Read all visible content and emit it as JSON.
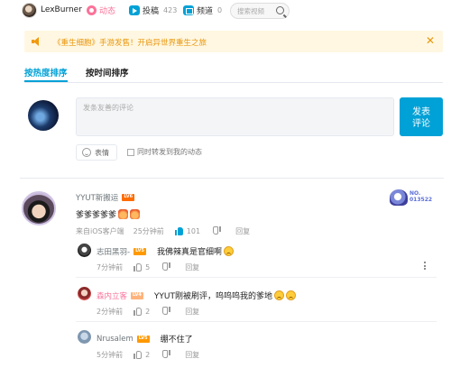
{
  "nav": {
    "username": "LexBurner",
    "dynamic_label": "动态",
    "submissions_label": "投稿",
    "submissions_count": "423",
    "channels_label": "频道",
    "channels_count": "0",
    "search_placeholder": "搜索视频"
  },
  "notice": {
    "text": "《重生细胞》手游发售！开启异世界重生之旅",
    "close": "✕"
  },
  "tabs": [
    {
      "label": "按热度排序",
      "active": true
    },
    {
      "label": "按时间排序",
      "active": false
    }
  ],
  "composer": {
    "placeholder": "发条友善的评论",
    "send_label": "发表\n评论",
    "emoji_label": "表情",
    "repost_label": "同时转发到我的动态"
  },
  "comment": {
    "username": "YYUT新搬运",
    "level": "LV6",
    "text": "爹爹爹爹爹",
    "source": "来自iOS客户端",
    "time": "25分钟前",
    "likes": "101",
    "reply_label": "回复",
    "badge_no": "NO.",
    "badge_num": "013522"
  },
  "replies": [
    {
      "username": "志田黑羽-",
      "level": "LV5",
      "text": "我佛辣真是官细啊",
      "time": "7分钟前",
      "likes": "5",
      "reply_label": "回复",
      "pink": false
    },
    {
      "username": "森内立客",
      "level": "LV4",
      "text": "YYUT刚被刷评，呜呜呜我的爹地",
      "time": "2分钟前",
      "likes": "2",
      "reply_label": "回复",
      "pink": true
    },
    {
      "username": "Nrusalem",
      "level": "LV5",
      "text": "绷不住了",
      "time": "5分钟前",
      "likes": "2",
      "reply_label": "回复",
      "pink": false
    }
  ],
  "colors": {
    "accent": "#00a1d6",
    "pink": "#fb7299",
    "notice_bg": "#fff7e1",
    "notice_text": "#e8960c"
  }
}
